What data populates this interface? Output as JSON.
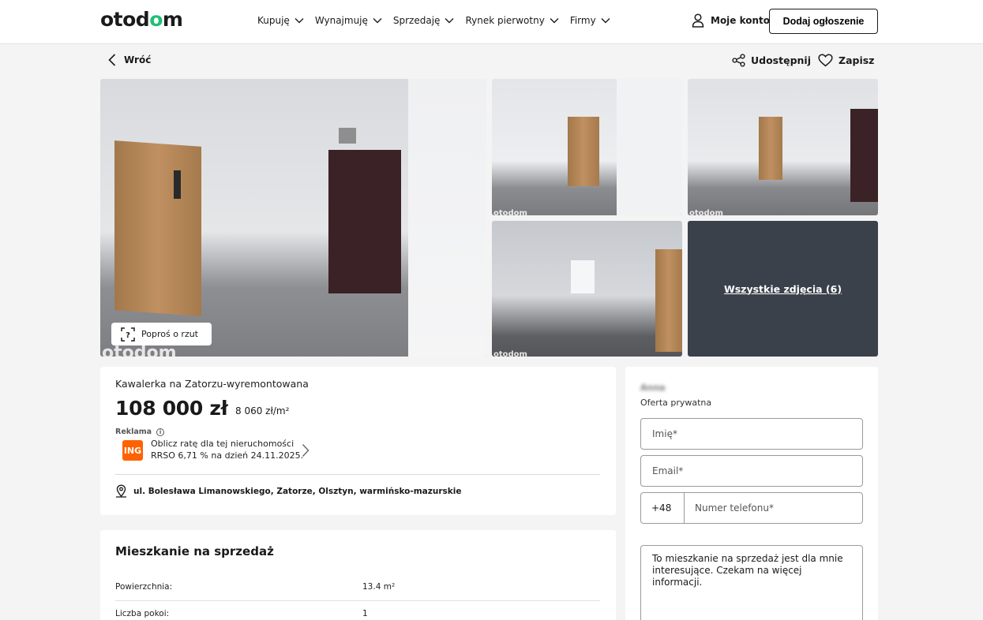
{
  "header": {
    "logo_pre": "otod",
    "logo_acc": "o",
    "logo_post": "m",
    "nav": [
      "Kupuję",
      "Wynajmuję",
      "Sprzedaję",
      "Rynek pierwotny",
      "Firmy"
    ],
    "account": "Moje konto",
    "add_listing": "Dodaj ogłoszenie"
  },
  "subheader": {
    "back": "Wróć",
    "share": "Udostępnij",
    "save": "Zapisz"
  },
  "gallery": {
    "floor_plan_button": "Poproś o rzut",
    "all_photos": "Wszystkie zdjęcia (6)",
    "watermark": "otodom"
  },
  "listing": {
    "title": "Kawalerka na Zatorzu-wyremontowana",
    "price": "108 000 zł",
    "price_per_m2": "8 060 zł/m²",
    "ad_label": "Reklama",
    "ad_line1": "Oblicz ratę dla tej nieruchomości",
    "ad_line2": "RRSO 6,71 % na dzień 24.11.2025.",
    "address": "ul. Bolesława Limanowskiego, Zatorze, Olsztyn, warmińsko-mazurskie"
  },
  "details": {
    "title": "Mieszkanie na sprzedaż",
    "rows": [
      {
        "label": "Powierzchnia:",
        "value": "13.4 m²"
      },
      {
        "label": "Liczba pokoi:",
        "value": "1"
      }
    ]
  },
  "contact": {
    "seller_name": "Anna",
    "offer_type": "Oferta prywatna",
    "name_placeholder": "Imię*",
    "email_placeholder": "Email*",
    "phone_prefix": "+48",
    "phone_placeholder": "Numer telefonu*",
    "message": "To mieszkanie na sprzedaż jest dla mnie interesujące. Czekam na więcej informacji."
  },
  "colors": {
    "brand_accent": "#1fbf75",
    "ing_orange": "#ff6200",
    "background": "#f4f4f5"
  }
}
